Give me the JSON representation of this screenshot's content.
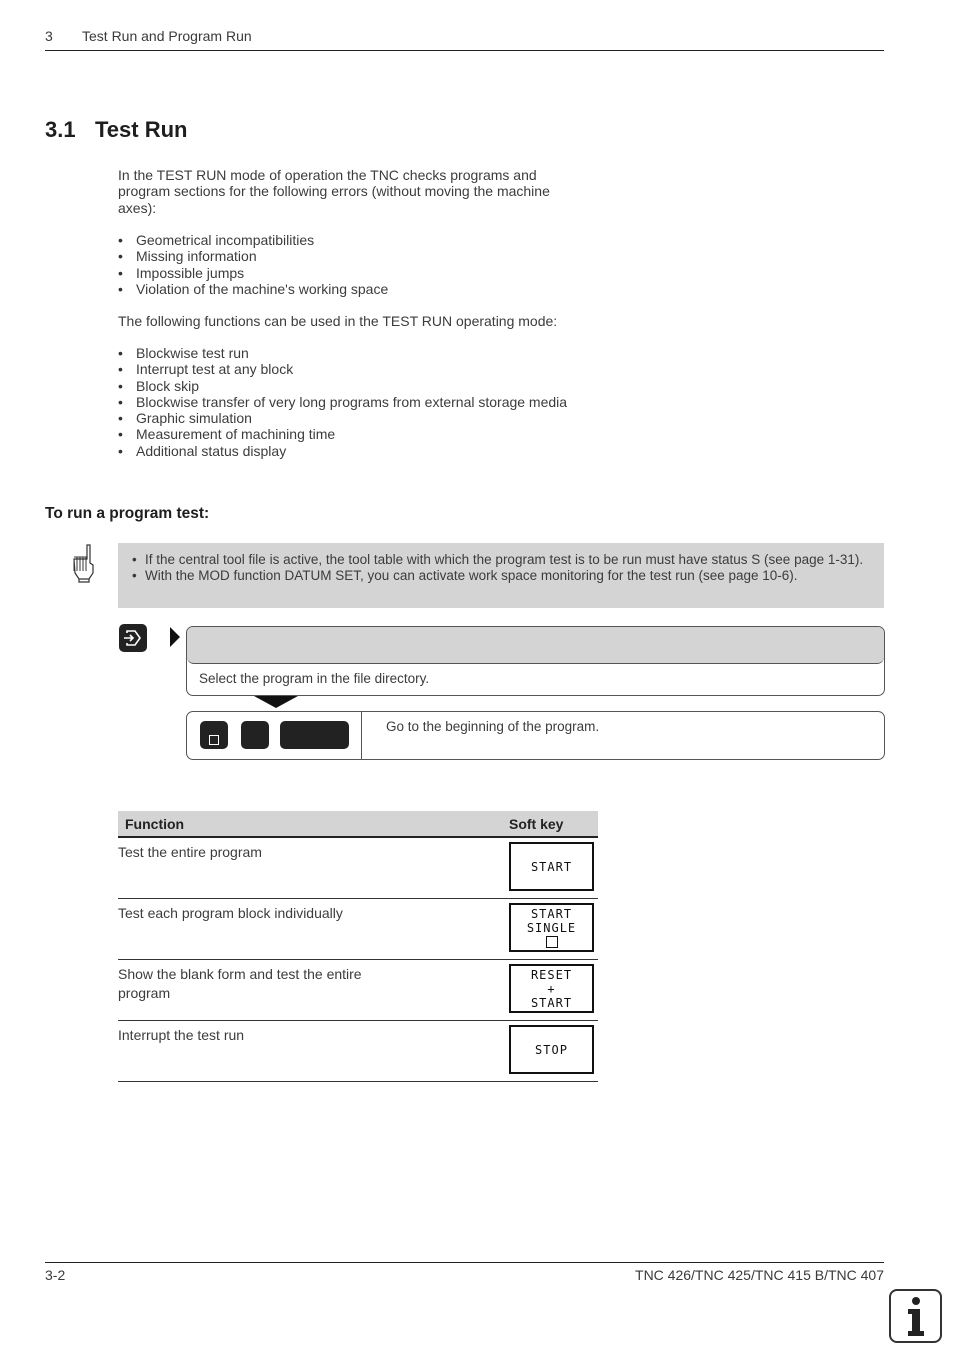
{
  "header": {
    "chapter_number": "3",
    "chapter_title": "Test Run and Program Run"
  },
  "section": {
    "number": "3.1",
    "title": "Test Run"
  },
  "intro": {
    "paragraph": "In the TEST RUN mode of operation the TNC checks programs and program sections for the following errors (without moving the machine axes):",
    "errors": [
      "Geometrical incompatibilities",
      "Missing information",
      "Impossible jumps",
      "Violation of the machine's working space"
    ],
    "functions_paragraph": "The following functions can be used in the TEST RUN operating mode:",
    "functions": [
      "Blockwise test run",
      "Interrupt test at any block",
      "Block skip",
      "Blockwise transfer of very long programs from external storage media",
      "Graphic simulation",
      "Measurement of machining time",
      "Additional status display"
    ]
  },
  "procedure": {
    "heading": "To run a program test:",
    "notes": [
      "If the central tool file is active, the tool table with which the program test is to be run must have status S (see page 1-31).",
      "With the MOD function DATUM SET, you can activate work space monitoring for the test run (see page 10-6)."
    ],
    "note_icon": "pointing-hand-icon",
    "steps": [
      {
        "key_icon": "pgm-mgt-key-icon",
        "text": "Select the program in the file directory."
      },
      {
        "key_icons": [
          "goto-key-icon",
          "zero-key-icon",
          "ent-key-icon"
        ],
        "text": "Go to the beginning of the program."
      }
    ]
  },
  "table": {
    "headers": {
      "function": "Function",
      "soft_key": "Soft key"
    },
    "rows": [
      {
        "function": "Test the entire program",
        "soft_key": [
          "START"
        ],
        "soft_key_has_box": false
      },
      {
        "function": "Test each program block individually",
        "soft_key": [
          "START",
          "SINGLE"
        ],
        "soft_key_has_box": true
      },
      {
        "function": "Show the blank form and test the entire program",
        "soft_key": [
          "RESET",
          "+",
          "START"
        ],
        "soft_key_has_box": false
      },
      {
        "function": "Interrupt the test run",
        "soft_key": [
          "STOP"
        ],
        "soft_key_has_box": false
      }
    ]
  },
  "footer": {
    "page": "3-2",
    "models": "TNC 426/TNC 425/TNC 415 B/TNC 407",
    "info_icon": "info-icon"
  }
}
